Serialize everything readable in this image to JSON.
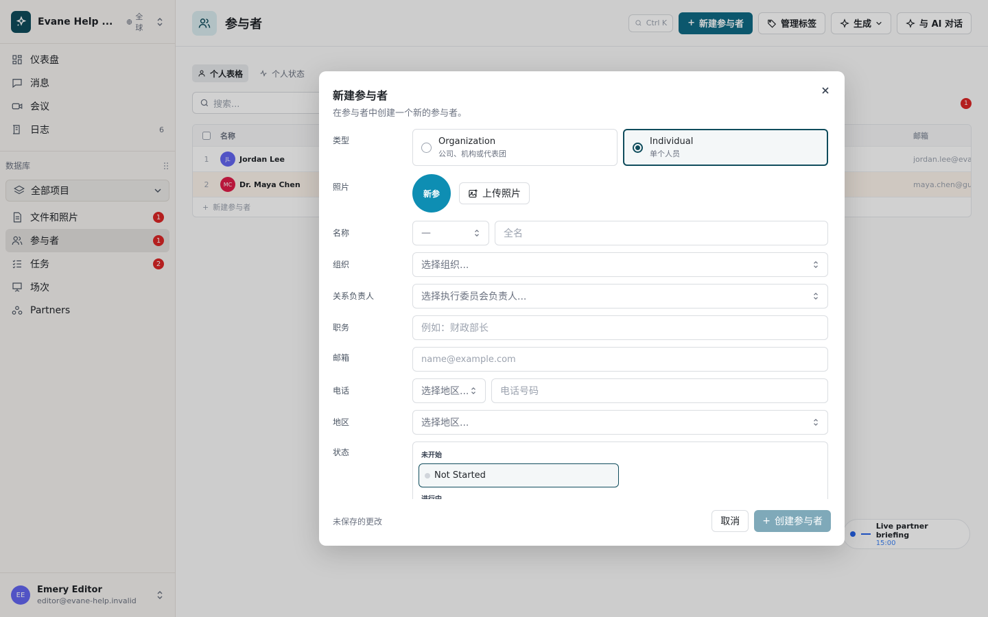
{
  "workspace": {
    "name": "Evane Help ...",
    "scope": "全球"
  },
  "sidebar": {
    "nav": [
      {
        "label": "仪表盘",
        "icon": "dashboard-icon"
      },
      {
        "label": "消息",
        "icon": "message-icon"
      },
      {
        "label": "会议",
        "icon": "video-icon"
      },
      {
        "label": "日志",
        "icon": "log-icon",
        "count": "6"
      }
    ],
    "section_label": "数据库",
    "project_select": "全部项目",
    "db_items": [
      {
        "label": "文件和照片",
        "badge": "1"
      },
      {
        "label": "参与者",
        "badge": "1"
      },
      {
        "label": "任务",
        "badge": "2"
      },
      {
        "label": "场次"
      },
      {
        "label": "Partners"
      }
    ]
  },
  "user": {
    "initials": "EE",
    "name": "Emery Editor",
    "email": "editor@evane-help.invalid"
  },
  "page": {
    "title": "参与者",
    "shortcut": "Ctrl K",
    "actions": {
      "new": "新建参与者",
      "tags": "管理标签",
      "generate": "生成",
      "ai": "与 AI 对话"
    },
    "tabs": [
      "个人表格",
      "个人状态"
    ],
    "search_placeholder": "搜索...",
    "error_count": "1",
    "table": {
      "headers": {
        "name": "名称",
        "email": "邮箱"
      },
      "rows": [
        {
          "index": "1",
          "initials": "JL",
          "name": "Jordan Lee",
          "email": "jordan.lee@eva"
        },
        {
          "index": "2",
          "initials": "MC",
          "name": "Dr. Maya Chen",
          "email": "maya.chen@gu"
        }
      ],
      "add_row": "新建参与者"
    },
    "live": {
      "title": "Live partner briefing",
      "time": "15:00"
    }
  },
  "modal": {
    "title": "新建参与者",
    "subtitle": "在参与者中创建一个新的参与者。",
    "labels": {
      "type": "类型",
      "photo": "照片",
      "name": "名称",
      "org": "组织",
      "owner": "关系负责人",
      "role": "职务",
      "email": "邮箱",
      "phone": "电话",
      "region": "地区",
      "status": "状态"
    },
    "type_options": [
      {
        "title": "Organization",
        "sub": "公司、机构或代表团"
      },
      {
        "title": "Individual",
        "sub": "单个人员"
      }
    ],
    "photo_initials": "新参",
    "upload_label": "上传照片",
    "prefix_value": "—",
    "fullname_placeholder": "全名",
    "org_placeholder": "选择组织...",
    "owner_placeholder": "选择执行委员会负责人...",
    "role_placeholder": "例如：财政部长",
    "email_placeholder": "name@example.com",
    "phone_region_placeholder": "选择地区...",
    "phone_placeholder": "电话号码",
    "region_placeholder": "选择地区...",
    "status": {
      "group1": "未开始",
      "selected": "Not Started",
      "group2": "进行中"
    },
    "footer": {
      "unsaved": "未保存的更改",
      "cancel": "取消",
      "create": "创建参与者"
    }
  }
}
